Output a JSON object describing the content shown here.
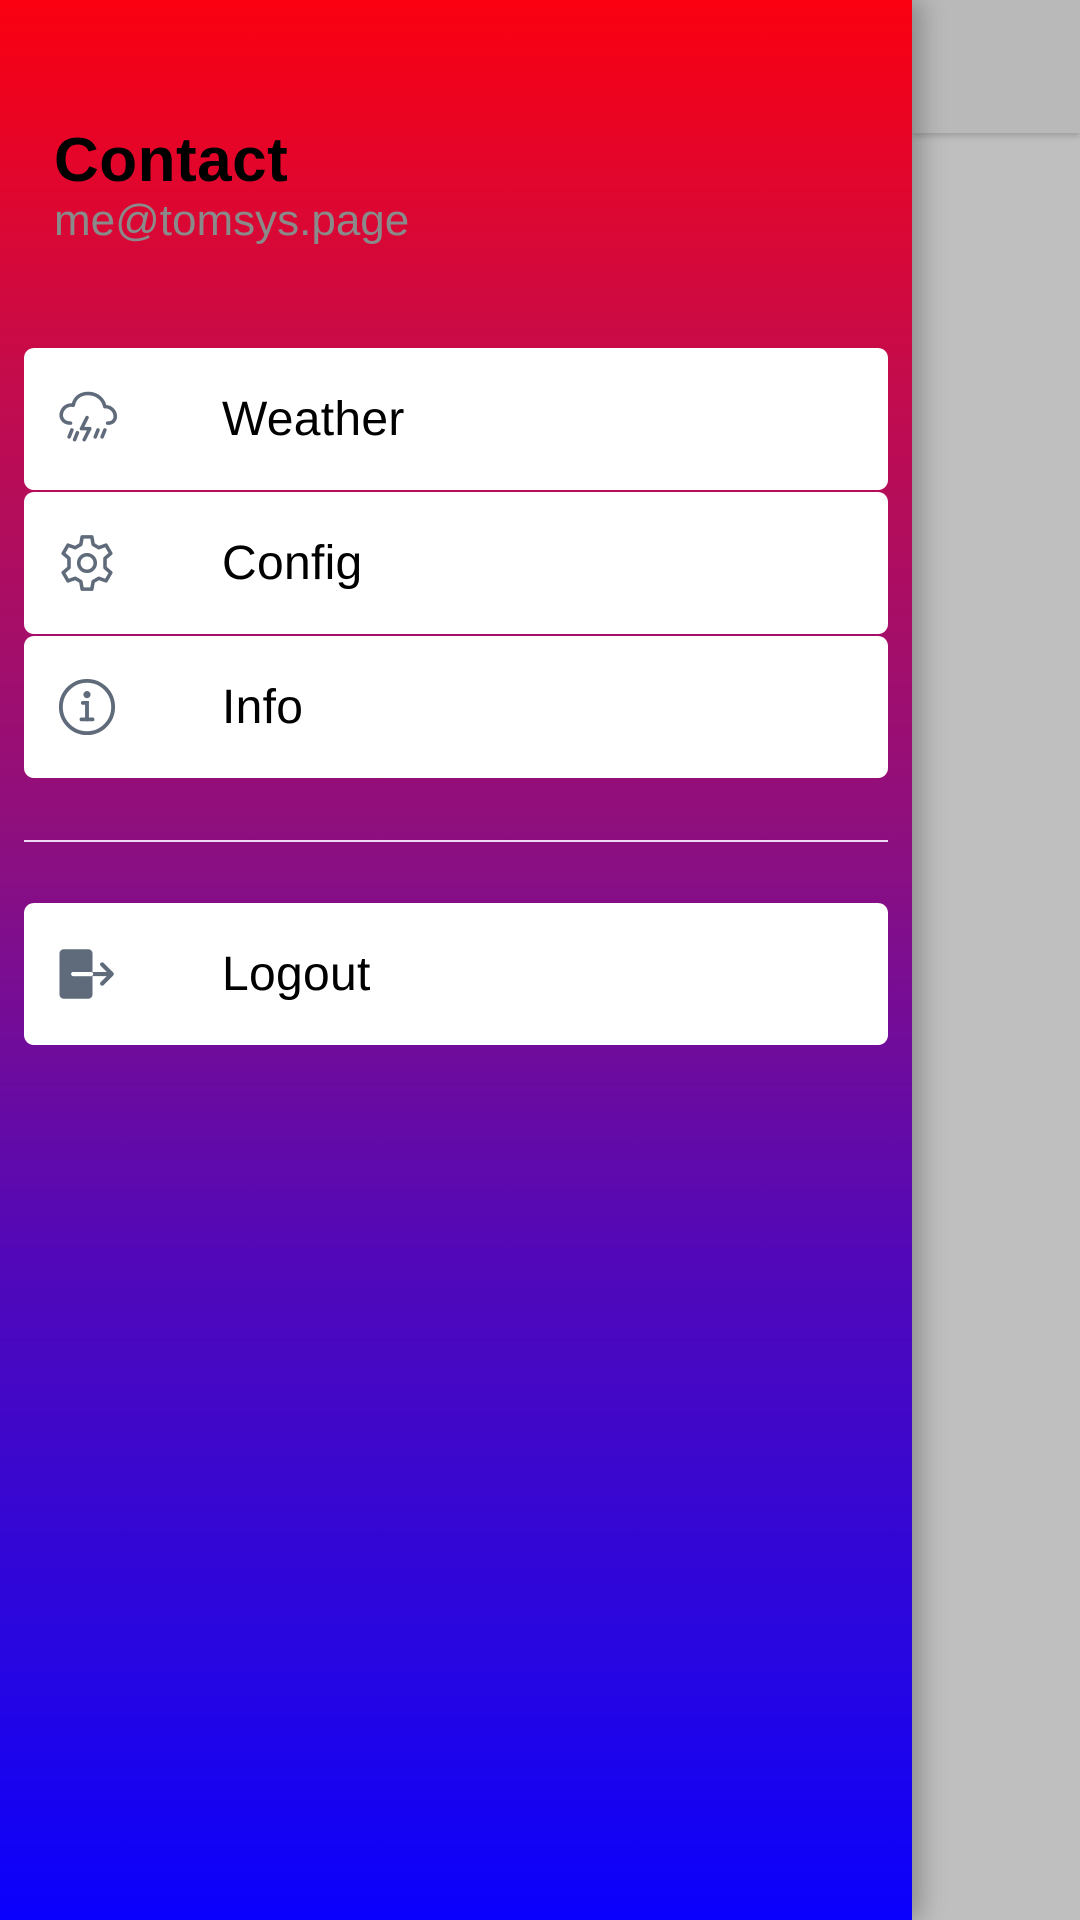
{
  "header": {
    "title": "Contact",
    "email": "me@tomsys.page"
  },
  "menu": {
    "items": [
      {
        "label": "Weather",
        "icon": "weather-storm-icon"
      },
      {
        "label": "Config",
        "icon": "gear-icon"
      },
      {
        "label": "Info",
        "icon": "info-icon"
      }
    ]
  },
  "logout": {
    "label": "Logout",
    "icon": "logout-icon"
  },
  "colors": {
    "gradient_top": "#fb0010",
    "gradient_bottom": "#0a00fd",
    "icon": "#5f6b7a",
    "subtitle": "#8a8a8a"
  }
}
